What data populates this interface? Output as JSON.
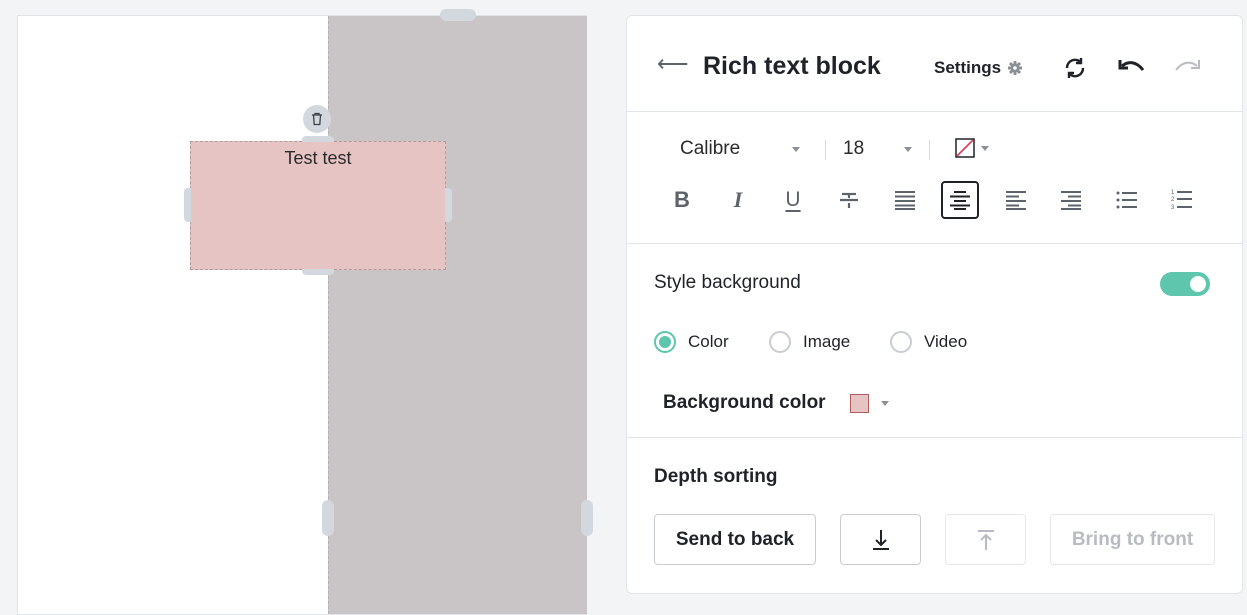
{
  "canvas": {
    "block_text": "Test test",
    "block_color": "#e6c4c4",
    "column_color": "#c9c4c5"
  },
  "panel": {
    "back_icon": "arrow-left-icon",
    "title": "Rich text block",
    "settings_label": "Settings",
    "settings_icon": "gear-icon"
  },
  "format": {
    "font_family": "Calibre",
    "font_size": "18",
    "text_color_icon": "no-color-swatch-icon",
    "buttons": [
      "bold",
      "italic",
      "underline",
      "strikethrough",
      "justify",
      "align-center",
      "align-left",
      "align-right",
      "bullet-list",
      "numbered-list"
    ],
    "active_button": "align-center"
  },
  "background": {
    "section_label": "Style background",
    "enabled": true,
    "options": [
      "Color",
      "Image",
      "Video"
    ],
    "selected": "Color",
    "color_label": "Background color",
    "color_value": "#e6c4c4",
    "accent": "#5dc6ad"
  },
  "depth": {
    "section_label": "Depth sorting",
    "send_to_back": "Send to back",
    "bring_to_front": "Bring to front"
  }
}
